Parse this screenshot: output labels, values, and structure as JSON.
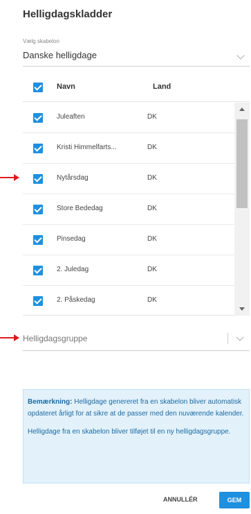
{
  "dialog": {
    "title": "Helligdagskladder",
    "template": {
      "label": "Vælg skabelon",
      "value": "Danske helligdage"
    },
    "table": {
      "headers": {
        "name": "Navn",
        "land": "Land"
      },
      "rows": [
        {
          "name": "Juleaften",
          "land": "DK",
          "checked": true
        },
        {
          "name": "Kristi Himmelfarts...",
          "land": "DK",
          "checked": true
        },
        {
          "name": "Nytårsdag",
          "land": "DK",
          "checked": true
        },
        {
          "name": "Store Bededag",
          "land": "DK",
          "checked": true
        },
        {
          "name": "Pinsedag",
          "land": "DK",
          "checked": true
        },
        {
          "name": "2. Juledag",
          "land": "DK",
          "checked": true
        },
        {
          "name": "2. Påskedag",
          "land": "DK",
          "checked": true
        }
      ]
    },
    "group": {
      "placeholder": "Helligdagsgruppe"
    },
    "note": {
      "bold": "Bemærkning:",
      "text1": " Helligdage genereret fra en skabelon bliver automatisk opdateret årligt for at sikre at de passer med den nuværende kalender.",
      "text2": "Helligdage fra en skabelon bliver tilføjet til en ny helligdagsgruppe."
    },
    "buttons": {
      "cancel": "ANNULLÉR",
      "save": "GEM"
    }
  },
  "colors": {
    "accent": "#1e90e0",
    "annotation_arrow": "#e11b1b",
    "note_bg": "#e3f1fa",
    "note_text": "#1a6aa3"
  }
}
